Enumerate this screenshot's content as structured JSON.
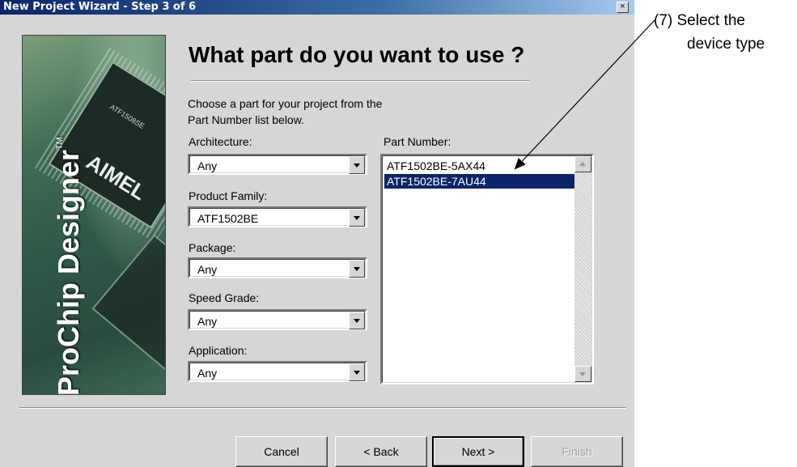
{
  "window": {
    "title": "New Project Wizard - Step 3 of 6",
    "close_glyph": "×"
  },
  "banner": {
    "brand": "ProChip Designer",
    "trademark": "TM",
    "chip_label_small": "ATF1508SE",
    "chip_label_large": "AIMEL"
  },
  "page": {
    "heading": "What part do you want to use ?",
    "instructions_line1": "Choose a part for your project from the",
    "instructions_line2": "Part Number list below."
  },
  "filters": {
    "architecture": {
      "label": "Architecture:",
      "value": "Any"
    },
    "product_family": {
      "label": "Product Family:",
      "value": "ATF1502BE"
    },
    "package": {
      "label": "Package:",
      "value": "Any"
    },
    "speed_grade": {
      "label": "Speed Grade:",
      "value": "Any"
    },
    "application": {
      "label": "Application:",
      "value": "Any"
    }
  },
  "part_number": {
    "label": "Part Number:",
    "items": [
      "ATF1502BE-5AX44",
      "ATF1502BE-7AU44"
    ],
    "selected": "ATF1502BE-7AU44"
  },
  "buttons": {
    "cancel": "Cancel",
    "back": "< Back",
    "next": "Next >",
    "finish": "Finish"
  },
  "annotation": {
    "line1": "(7)  Select the",
    "line2": "device type"
  },
  "colors": {
    "titlebar": "#0b246a",
    "dialog_bg": "#d6d6d6",
    "selection": "#0b246a"
  }
}
